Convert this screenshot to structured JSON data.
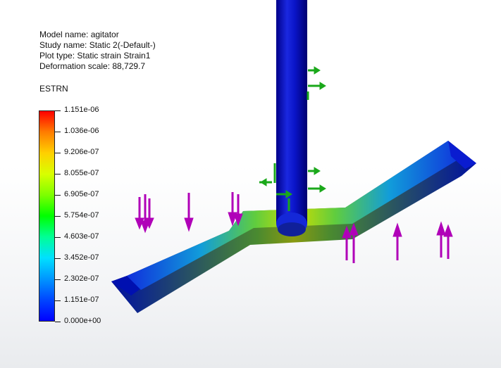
{
  "info": {
    "model_name": "Model name: agitator",
    "study_name": "Study name: Static 2(-Default-)",
    "plot_type": "Plot type: Static strain Strain1",
    "deformation_scale": "Deformation scale: 88,729.7"
  },
  "legend": {
    "title": "ESTRN",
    "ticks": [
      "1.151e-06",
      "1.036e-06",
      "9.206e-07",
      "8.055e-07",
      "6.905e-07",
      "5.754e-07",
      "4.603e-07",
      "3.452e-07",
      "2.302e-07",
      "1.151e-07",
      "0.000e+00"
    ]
  },
  "colors": {
    "shaft": "#0a14c8",
    "load_arrow": "#b000b8",
    "fixture_arrow": "#1aa81a"
  }
}
